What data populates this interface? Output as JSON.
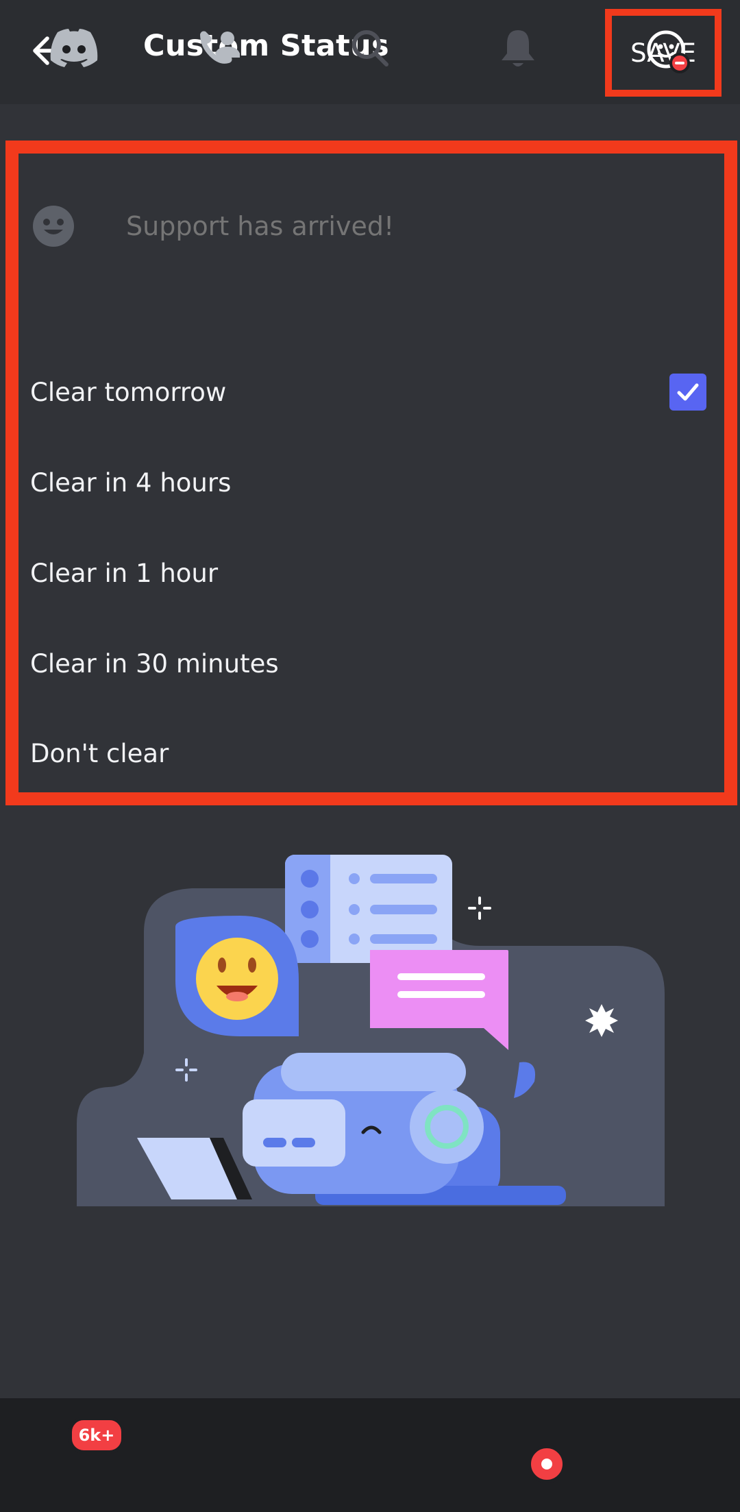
{
  "header": {
    "title": "Custom Status",
    "save_label": "SAVE",
    "back_icon": "arrow-left-icon"
  },
  "status": {
    "emoji_icon": "smiley-icon",
    "placeholder": "Support has arrived!"
  },
  "clear_options": [
    {
      "label": "Clear tomorrow",
      "selected": true
    },
    {
      "label": "Clear in 4 hours",
      "selected": false
    },
    {
      "label": "Clear in 1 hour",
      "selected": false
    },
    {
      "label": "Clear in 30 minutes",
      "selected": false
    },
    {
      "label": "Don't clear",
      "selected": false
    }
  ],
  "bottom_nav": {
    "items": [
      {
        "icon": "discord-icon",
        "badge": "6k+"
      },
      {
        "icon": "friends-icon"
      },
      {
        "icon": "search-icon"
      },
      {
        "icon": "bell-icon",
        "dot": true
      },
      {
        "icon": "profile-icon"
      }
    ]
  },
  "colors": {
    "background": "#313338",
    "header": "#2b2d31",
    "nav": "#1e1f22",
    "accent": "#5865f2",
    "highlight": "#f23a1c",
    "badge": "#f23f43"
  }
}
